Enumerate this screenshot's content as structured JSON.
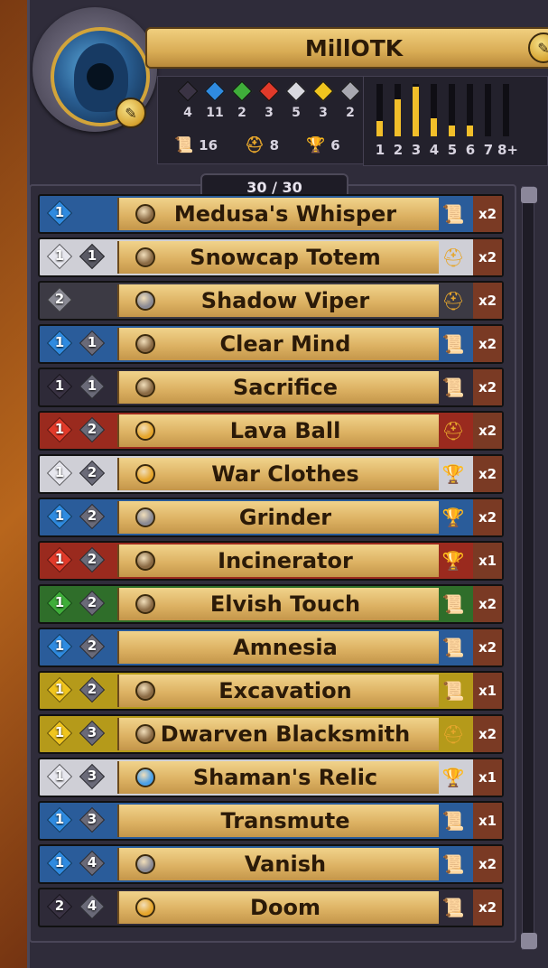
{
  "deck": {
    "player_name": "MillOTK",
    "card_count": "30 / 30"
  },
  "gem_totals": [
    {
      "color": "#3a3344",
      "count": "4"
    },
    {
      "color": "#2f8be0",
      "count": "11"
    },
    {
      "color": "#3fae3a",
      "count": "2"
    },
    {
      "color": "#e23a2a",
      "count": "3"
    },
    {
      "color": "#d9d9df",
      "count": "5"
    },
    {
      "color": "#f0c51e",
      "count": "3"
    },
    {
      "color": "#a8a8b0",
      "count": "2"
    }
  ],
  "type_totals": [
    {
      "icon": "scroll-icon",
      "glyph": "📜",
      "count": "16"
    },
    {
      "icon": "helmet-icon",
      "glyph": "⛑",
      "count": "8"
    },
    {
      "icon": "trophy-icon",
      "glyph": "🏆",
      "count": "6"
    }
  ],
  "mana_curve": {
    "labels": [
      "1",
      "2",
      "3",
      "4",
      "5",
      "6",
      "7",
      "8+"
    ],
    "fill_fraction": [
      0.3,
      0.7,
      0.95,
      0.35,
      0.2,
      0.2,
      0.0,
      0.0
    ]
  },
  "cards": [
    {
      "name": "Medusa's Whisper",
      "color": "#2a5c9a",
      "cost": [
        "1"
      ],
      "cost_colors": [
        "#2f8be0"
      ],
      "rarity": "#8a6a44",
      "type": "scroll-icon",
      "type_glyph": "📜",
      "qty": "x2"
    },
    {
      "name": "Snowcap Totem",
      "color": "#cfcfd6",
      "cost": [
        "1",
        "1"
      ],
      "cost_colors": [
        "#e7e7ee",
        "#5a5a64"
      ],
      "rarity": "#8a6a44",
      "type": "helmet-icon",
      "type_glyph": "⛑",
      "qty": "x2"
    },
    {
      "name": "Shadow Viper",
      "color": "#3c3a44",
      "cost": [
        "2"
      ],
      "cost_colors": [
        "#8a8a94"
      ],
      "rarity": "#8a8a94",
      "type": "helmet-icon",
      "type_glyph": "⛑",
      "qty": "x2"
    },
    {
      "name": "Clear Mind",
      "color": "#2a5c9a",
      "cost": [
        "1",
        "1"
      ],
      "cost_colors": [
        "#2f8be0",
        "#6a6a78"
      ],
      "rarity": "#8a6a44",
      "type": "scroll-icon",
      "type_glyph": "📜",
      "qty": "x2"
    },
    {
      "name": "Sacrifice",
      "color": "#2e2a38",
      "cost": [
        "1",
        "1"
      ],
      "cost_colors": [
        "#3a3344",
        "#6a6a78"
      ],
      "rarity": "#8a6a44",
      "type": "scroll-icon",
      "type_glyph": "📜",
      "qty": "x2"
    },
    {
      "name": "Lava Ball",
      "color": "#9a2a1e",
      "cost": [
        "1",
        "2"
      ],
      "cost_colors": [
        "#e23a2a",
        "#6a6a78"
      ],
      "rarity": "#e6a62c",
      "type": "helmet-icon",
      "type_glyph": "⛑",
      "qty": "x2"
    },
    {
      "name": "War Clothes",
      "color": "#cfcfd6",
      "cost": [
        "1",
        "2"
      ],
      "cost_colors": [
        "#e7e7ee",
        "#6a6a78"
      ],
      "rarity": "#e6a62c",
      "type": "trophy-icon",
      "type_glyph": "🏆",
      "qty": "x2"
    },
    {
      "name": "Grinder",
      "color": "#2a5c9a",
      "cost": [
        "1",
        "2"
      ],
      "cost_colors": [
        "#2f8be0",
        "#6a6a78"
      ],
      "rarity": "#8a8a94",
      "type": "trophy-icon",
      "type_glyph": "🏆",
      "qty": "x2"
    },
    {
      "name": "Incinerator",
      "color": "#9a2a1e",
      "cost": [
        "1",
        "2"
      ],
      "cost_colors": [
        "#e23a2a",
        "#6a6a78"
      ],
      "rarity": "#8a6a44",
      "type": "trophy-icon",
      "type_glyph": "🏆",
      "qty": "x1"
    },
    {
      "name": "Elvish Touch",
      "color": "#2f6e2a",
      "cost": [
        "1",
        "2"
      ],
      "cost_colors": [
        "#3fae3a",
        "#6a6a78"
      ],
      "rarity": "#8a6a44",
      "type": "scroll-icon",
      "type_glyph": "📜",
      "qty": "x2"
    },
    {
      "name": "Amnesia",
      "color": "#2a5c9a",
      "cost": [
        "1",
        "2"
      ],
      "cost_colors": [
        "#2f8be0",
        "#6a6a78"
      ],
      "rarity": "",
      "type": "scroll-icon",
      "type_glyph": "📜",
      "qty": "x2"
    },
    {
      "name": "Excavation",
      "color": "#b59a1a",
      "cost": [
        "1",
        "2"
      ],
      "cost_colors": [
        "#f0c51e",
        "#6a6a78"
      ],
      "rarity": "#8a6a44",
      "type": "scroll-icon",
      "type_glyph": "📜",
      "qty": "x1"
    },
    {
      "name": "Dwarven Blacksmith",
      "color": "#b59a1a",
      "cost": [
        "1",
        "3"
      ],
      "cost_colors": [
        "#f0c51e",
        "#6a6a78"
      ],
      "rarity": "#8a6a44",
      "type": "helmet-icon",
      "type_glyph": "⛑",
      "qty": "x2"
    },
    {
      "name": "Shaman's Relic",
      "color": "#cfcfd6",
      "cost": [
        "1",
        "3"
      ],
      "cost_colors": [
        "#e7e7ee",
        "#6a6a78"
      ],
      "rarity": "#4aa0e8",
      "type": "trophy-icon",
      "type_glyph": "🏆",
      "qty": "x1"
    },
    {
      "name": "Transmute",
      "color": "#2a5c9a",
      "cost": [
        "1",
        "3"
      ],
      "cost_colors": [
        "#2f8be0",
        "#6a6a78"
      ],
      "rarity": "",
      "type": "scroll-icon",
      "type_glyph": "📜",
      "qty": "x1"
    },
    {
      "name": "Vanish",
      "color": "#2a5c9a",
      "cost": [
        "1",
        "4"
      ],
      "cost_colors": [
        "#2f8be0",
        "#6a6a78"
      ],
      "rarity": "#8a8a94",
      "type": "scroll-icon",
      "type_glyph": "📜",
      "qty": "x2"
    },
    {
      "name": "Doom",
      "color": "#2e2a38",
      "cost": [
        "2",
        "4"
      ],
      "cost_colors": [
        "#3a3344",
        "#6a6a78"
      ],
      "rarity": "#e6a62c",
      "type": "scroll-icon",
      "type_glyph": "📜",
      "qty": "x2"
    }
  ]
}
